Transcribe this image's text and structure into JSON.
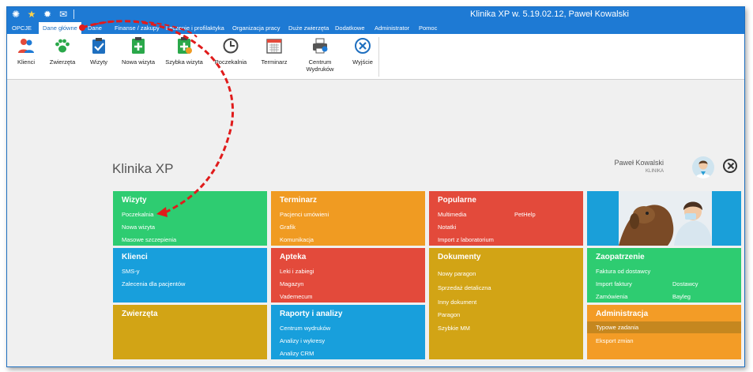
{
  "window": {
    "title": "Klinika XP w. 5.19.02.12, Paweł Kowalski"
  },
  "menu": [
    "OPCJE",
    "Dane główne",
    "Dane",
    "Finanse / zakupy",
    "Leczenie i profilaktyka",
    "Organizacja pracy",
    "Duże zwierzęta",
    "Dodatkowe",
    "Administrator",
    "Pomoc"
  ],
  "ribbon": [
    "Klienci",
    "Zwierzęta",
    "Wizyty",
    "Nowa wizyta",
    "Szybka wizyta",
    "Poczekalnia",
    "Terminarz",
    "Centrum Wydruków",
    "Wyjście"
  ],
  "heading": "Klinika XP",
  "user": {
    "name": "Paweł Kowalski",
    "clinic": "KLINIKA"
  },
  "tiles": {
    "wizyty": {
      "title": "Wizyty",
      "items": [
        "Poczekalnia",
        "Nowa wizyta",
        "Masowe szczepienia"
      ]
    },
    "terminarz": {
      "title": "Terminarz",
      "items": [
        "Pacjenci umówieni",
        "Grafik",
        "Komunikacja"
      ]
    },
    "popularne": {
      "title": "Popularne",
      "items": [
        "Multimedia",
        "PetHelp",
        "Notatki",
        "Import z laboratorium"
      ]
    },
    "klienci": {
      "title": "Klienci",
      "items": [
        "SMS-y",
        "Zalecenia dla pacjentów"
      ]
    },
    "apteka": {
      "title": "Apteka",
      "items": [
        "Leki i zabiegi",
        "Magazyn",
        "Vademecum"
      ]
    },
    "dokumenty": {
      "title": "Dokumenty",
      "items": [
        "Nowy paragon",
        "Sprzedaż detaliczna",
        "Inny dokument",
        "Paragon",
        "Szybkie MM"
      ]
    },
    "zaopatrzenie": {
      "title": "Zaopatrzenie",
      "items": [
        "Faktura od dostawcy",
        "Import faktury",
        "Dostawcy",
        "Zamówienia",
        "Bayleg"
      ]
    },
    "zwierzeta": {
      "title": "Zwierzęta"
    },
    "raporty": {
      "title": "Raporty i analizy",
      "items": [
        "Centrum wydruków",
        "Analizy i wykresy",
        "Analizy CRM"
      ]
    },
    "administracja": {
      "title": "Administracja",
      "items": [
        "Typowe zadania",
        "Eksport zmian"
      ]
    }
  },
  "colors": {
    "accent": "#1e7ad4",
    "green": "#2ecc71",
    "orange": "#f09b22",
    "red": "#e34a3b",
    "blue": "#189fdc",
    "mustard": "#d2a415",
    "arrow": "#e01b1b"
  },
  "icons": [
    "klienci-icon",
    "paw-icon",
    "clipboard-check-icon",
    "plus-document-icon",
    "quick-visit-icon",
    "clock-icon",
    "calendar-icon",
    "printer-icon",
    "exit-x-icon",
    "star-icon",
    "gear-icon",
    "mail-icon"
  ]
}
